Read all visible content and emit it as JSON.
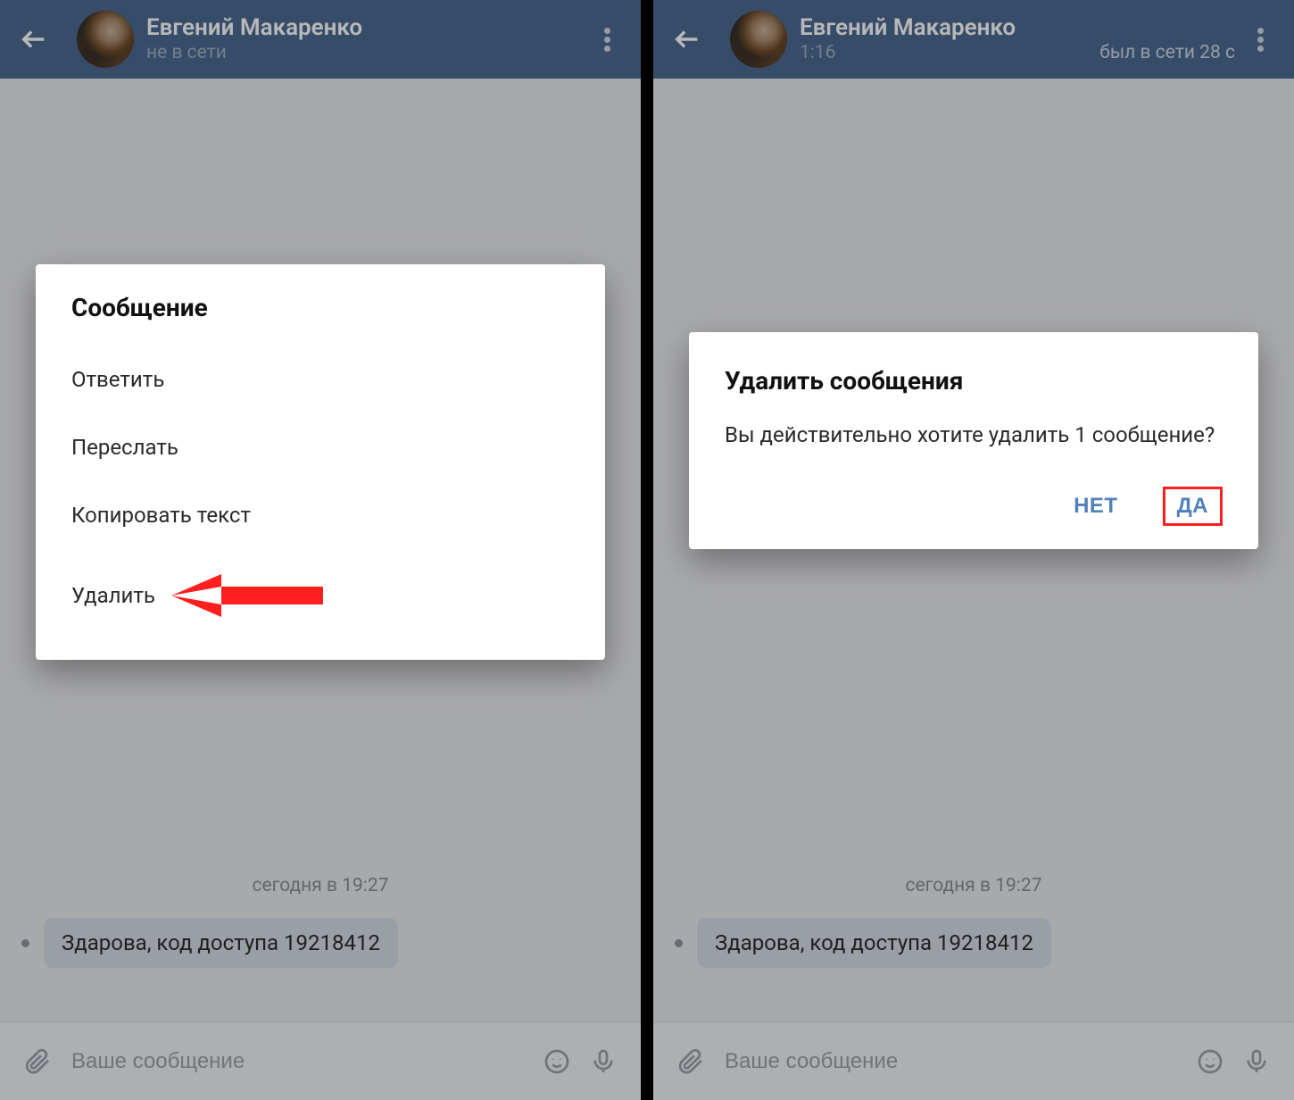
{
  "left": {
    "header": {
      "name": "Евгений Макаренко",
      "status": "не в сети"
    },
    "chat": {
      "date_separator": "сегодня в 19:27",
      "message": "Здарова, код доступа 19218412"
    },
    "composer": {
      "placeholder": "Ваше сообщение"
    },
    "dialog": {
      "title": "Сообщение",
      "items": {
        "reply": "Ответить",
        "forward": "Переслать",
        "copy": "Копировать текст",
        "delete": "Удалить"
      }
    }
  },
  "right": {
    "header": {
      "name": "Евгений Макаренко",
      "time": "1:16",
      "status": "был в сети 28 с"
    },
    "chat": {
      "date_separator": "сегодня в 19:27",
      "message": "Здарова, код доступа 19218412"
    },
    "composer": {
      "placeholder": "Ваше сообщение"
    },
    "dialog": {
      "title": "Удалить сообщения",
      "message": "Вы действительно хотите удалить 1 сообщение?",
      "no": "НЕТ",
      "yes": "ДА"
    }
  },
  "colors": {
    "accent": "#5181b8",
    "header": "#4b6a92",
    "annotation": "#ff1f1f"
  }
}
